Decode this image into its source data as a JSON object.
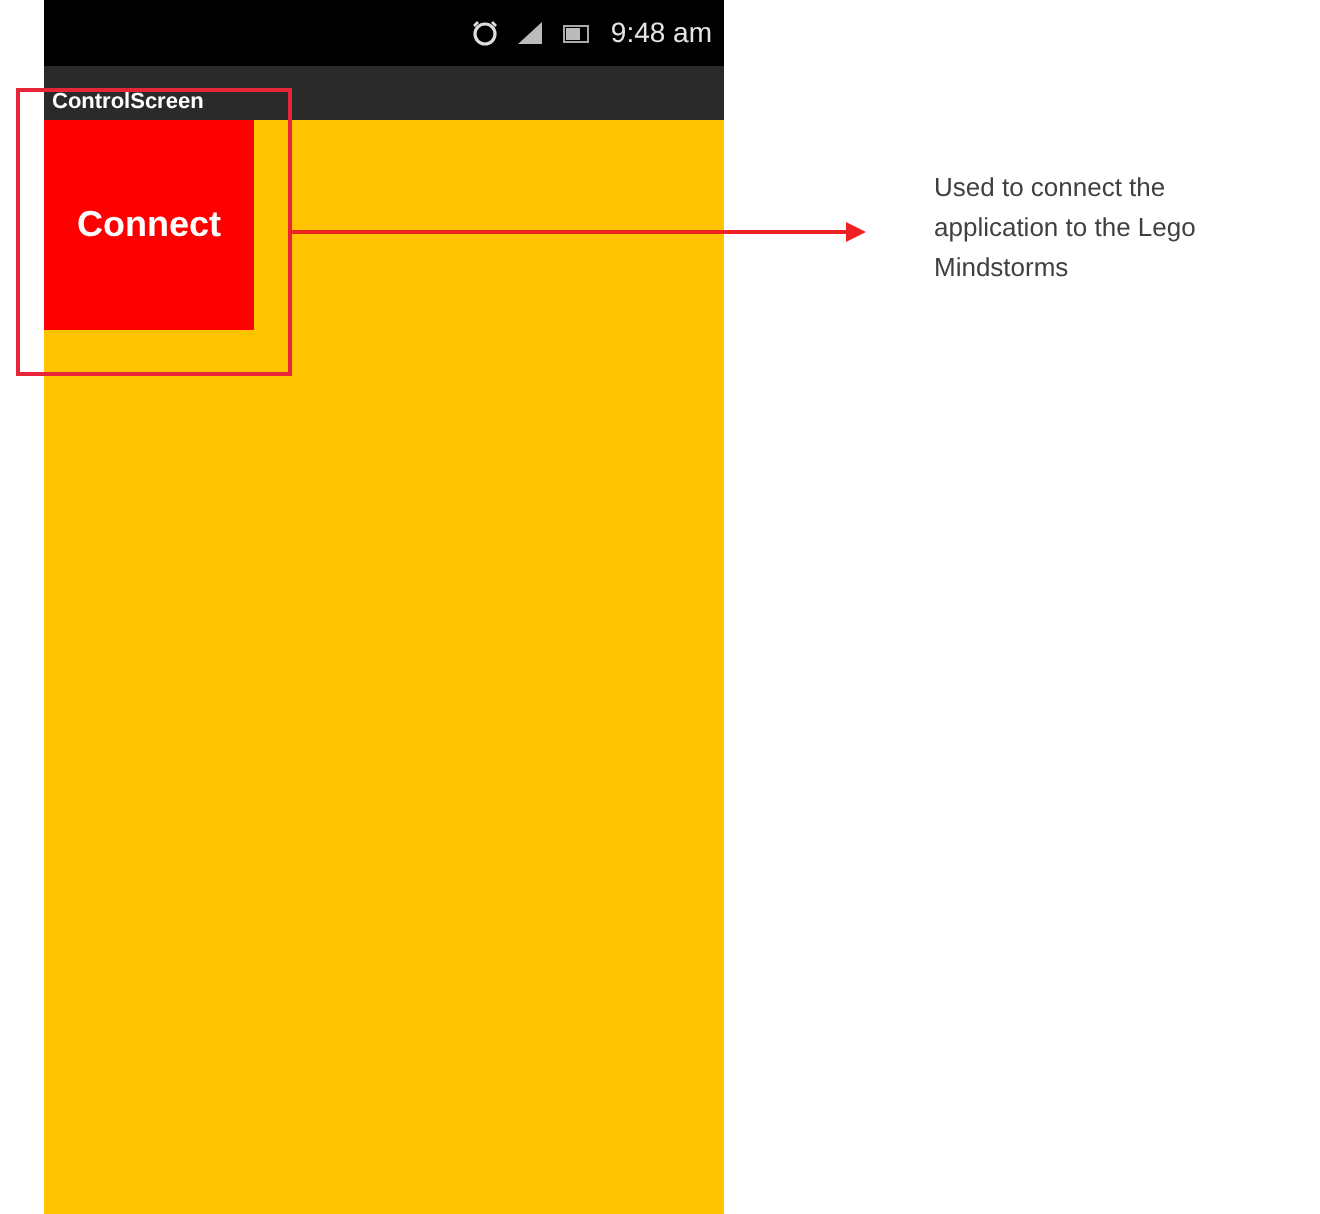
{
  "status_bar": {
    "time": "9:48 am"
  },
  "app_bar": {
    "title": "ControlScreen"
  },
  "connect_button": {
    "label": "Connect"
  },
  "annotation": {
    "text": "Used to connect the application to the Lego Mindstorms"
  }
}
